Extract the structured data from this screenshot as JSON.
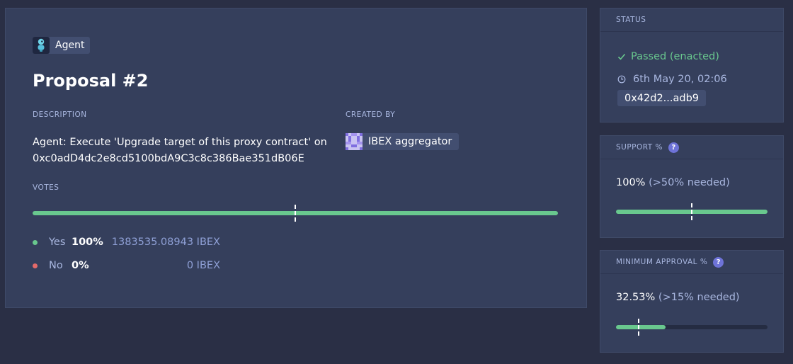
{
  "colors": {
    "accent_green": "#69c88e",
    "no_red": "#e36a6a",
    "card": "#353f5c",
    "background": "#2a2f45"
  },
  "proposal": {
    "app_badge": {
      "icon": "agent-robot-icon",
      "label": "Agent"
    },
    "title": "Proposal #2",
    "description_label": "DESCRIPTION",
    "description_line1": "Agent: Execute 'Upgrade target of this proxy contract' on",
    "description_line2": "0xc0adD4dc2e8cd5100bdA9C3c8c386Bae351dB06E",
    "created_by_label": "CREATED BY",
    "creator": {
      "icon": "identicon-icon",
      "name": "IBEX aggregator"
    },
    "votes_label": "VOTES",
    "votes_bar": {
      "yes_fraction": 1.0,
      "threshold_fraction": 0.5
    },
    "votes": [
      {
        "name": "Yes",
        "percent": "100%",
        "amount": "1383535.08943 IBEX",
        "color": "#69c88e"
      },
      {
        "name": "No",
        "percent": "0%",
        "amount": "0 IBEX",
        "color": "#e36a6a"
      }
    ]
  },
  "status": {
    "header": "STATUS",
    "state_icon": "check-icon",
    "state": "Passed (enacted)",
    "date_icon": "clock-icon",
    "date": "6th May 20, 02:06",
    "tx_hash": "0x42d2...adb9"
  },
  "support": {
    "header": "SUPPORT %",
    "help": "?",
    "value": "100%",
    "needed": "(>50% needed)",
    "fill_fraction": 1.0,
    "threshold_fraction": 0.5
  },
  "min_approval": {
    "header": "MINIMUM APPROVAL %",
    "help": "?",
    "value": "32.53%",
    "needed": "(>15% needed)",
    "fill_fraction": 0.3253,
    "threshold_fraction": 0.15
  }
}
